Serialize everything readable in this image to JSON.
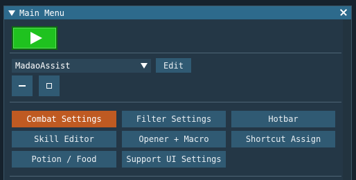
{
  "window": {
    "title": "Main Menu",
    "collapse_icon": "triangle-down-icon",
    "close_icon": "close-icon"
  },
  "toolbar": {
    "play_icon": "play-icon",
    "play_color": "#1fc21f"
  },
  "profile": {
    "selected": "MadaoAssist",
    "edit_label": "Edit"
  },
  "window_controls": {
    "minimize_icon": "minimize-icon",
    "square_icon": "square-icon"
  },
  "menu": {
    "items": [
      {
        "label": "Combat Settings",
        "active": true
      },
      {
        "label": "Filter Settings",
        "active": false
      },
      {
        "label": "Hotbar",
        "active": false
      },
      {
        "label": "Skill Editor",
        "active": false
      },
      {
        "label": "Opener + Macro",
        "active": false
      },
      {
        "label": "Shortcut Assign",
        "active": false
      },
      {
        "label": "Potion / Food",
        "active": false
      },
      {
        "label": "Support UI Settings",
        "active": false
      }
    ]
  },
  "colors": {
    "title_bar": "#2d6a8c",
    "window_bg": "#243746",
    "button": "#305a73",
    "active_button": "#bf5a22"
  }
}
